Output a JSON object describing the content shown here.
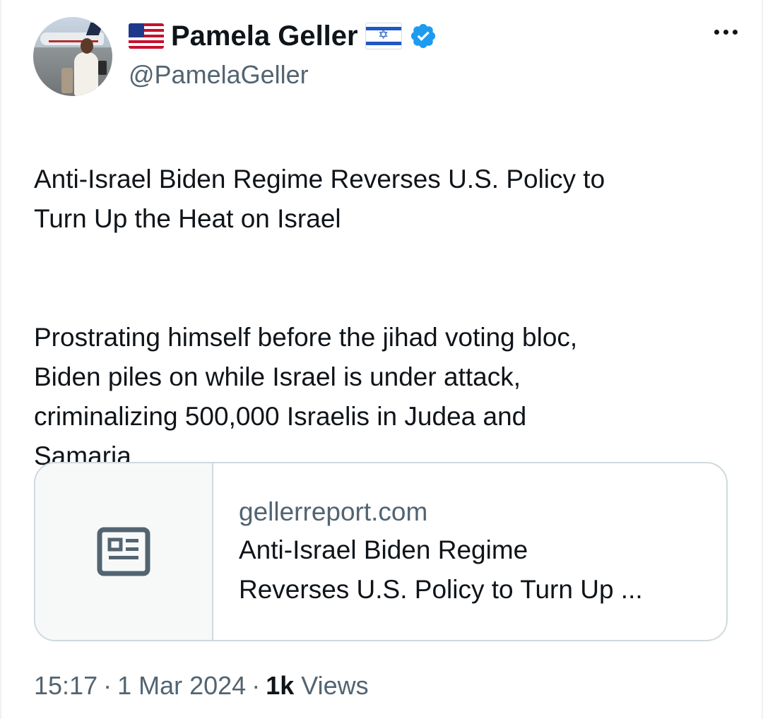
{
  "author": {
    "flag_left": "🇺🇸",
    "display_name": "Pamela Geller",
    "flag_right": "🇮🇱",
    "verified": true,
    "handle": "@PamelaGeller"
  },
  "tweet": {
    "paragraphs": [
      "Anti-Israel Biden Regime Reverses U.S. Policy to\nTurn Up the Heat on Israel",
      "Prostrating himself before the jihad voting bloc,\nBiden piles on while  Israel is under attack,\ncriminalizing 500,000 Israelis in Judea and\nSamaria."
    ]
  },
  "link_card": {
    "icon": "article-icon",
    "domain": "gellerreport.com",
    "title": "Anti-Israel Biden Regime\nReverses U.S. Policy to Turn Up ..."
  },
  "meta": {
    "time": "15:17",
    "separator": "·",
    "date": "1 Mar 2024",
    "views_count": "1k",
    "views_label": "Views"
  },
  "colors": {
    "text_primary": "#0f1419",
    "text_secondary": "#536471",
    "verified_blue": "#1d9bf0",
    "card_border": "#cfd9de"
  }
}
